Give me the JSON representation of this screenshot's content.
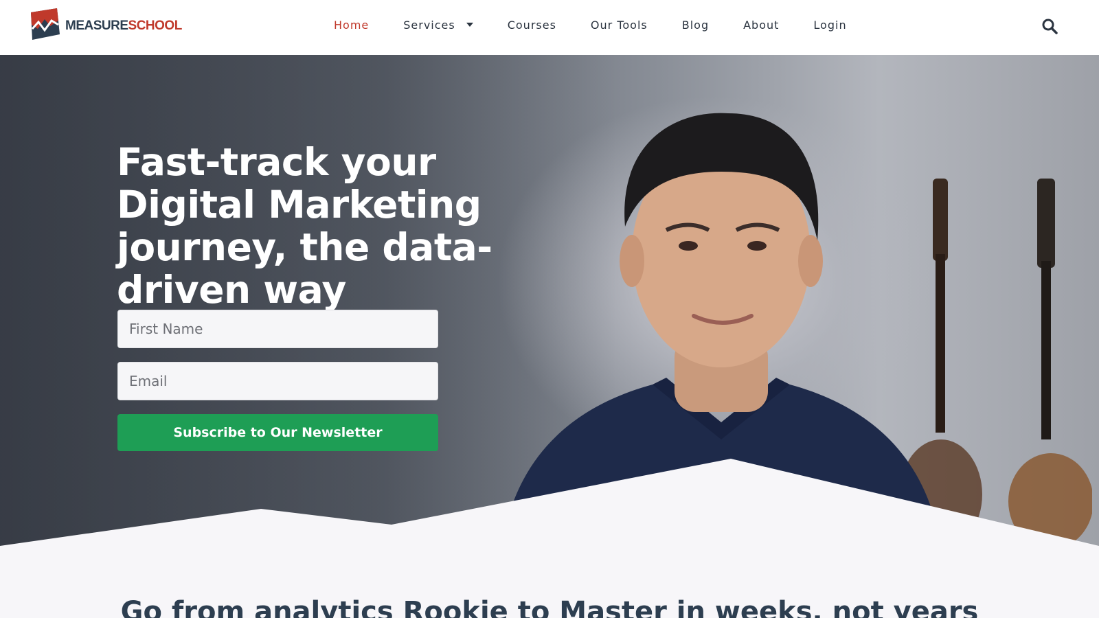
{
  "brand": {
    "name_part1": "MEASURE",
    "name_part2": "SCHOOL",
    "primary_color": "#2c3e50",
    "accent_color": "#c0392b"
  },
  "nav": {
    "items": [
      {
        "label": "Home",
        "active": true
      },
      {
        "label": "Services",
        "dropdown": true
      },
      {
        "label": "Courses"
      },
      {
        "label": "Our Tools"
      },
      {
        "label": "Blog"
      },
      {
        "label": "About"
      },
      {
        "label": "Login"
      }
    ],
    "search_icon": "search-icon"
  },
  "hero": {
    "title": "Fast-track your Digital Marketing journey, the data-driven way",
    "form": {
      "first_name_placeholder": "First Name",
      "email_placeholder": "Email",
      "submit_label": "Subscribe to Our Newsletter",
      "submit_color": "#1e9e55"
    }
  },
  "section": {
    "tagline": "Go from analytics Rookie to Master in weeks, not years"
  }
}
